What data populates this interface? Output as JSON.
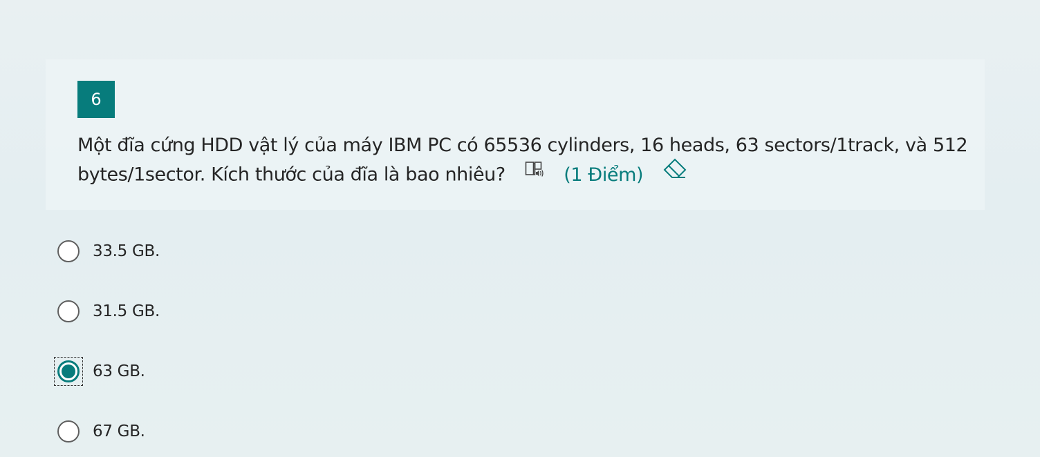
{
  "question": {
    "number": "6",
    "text": "Một đĩa cứng HDD vật lý của máy IBM PC có 65536 cylinders, 16 heads, 63 sectors/1track, và 512 bytes/1sector. Kích thước của đĩa là bao nhiêu?",
    "points": "(1 Điểm)",
    "accent_color": "#077c7c"
  },
  "icons": {
    "reader": "immersive-reader-icon",
    "clear": "eraser-icon"
  },
  "options": [
    {
      "label": "33.5 GB.",
      "selected": false
    },
    {
      "label": "31.5 GB.",
      "selected": false
    },
    {
      "label": "63 GB.",
      "selected": true
    },
    {
      "label": "67 GB.",
      "selected": false
    }
  ]
}
